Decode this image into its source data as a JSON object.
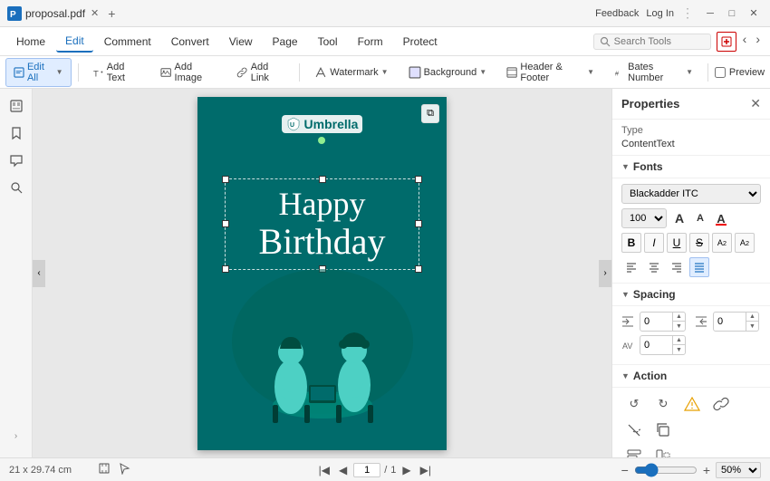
{
  "titlebar": {
    "filename": "proposal.pdf",
    "feedback": "Feedback",
    "login": "Log In"
  },
  "menubar": {
    "items": [
      {
        "label": "Home",
        "active": false
      },
      {
        "label": "Edit",
        "active": true
      },
      {
        "label": "Comment",
        "active": false
      },
      {
        "label": "Convert",
        "active": false
      },
      {
        "label": "View",
        "active": false
      },
      {
        "label": "Page",
        "active": false
      },
      {
        "label": "Tool",
        "active": false
      },
      {
        "label": "Form",
        "active": false
      },
      {
        "label": "Protect",
        "active": false
      }
    ],
    "search_placeholder": "Search Tools"
  },
  "toolbar": {
    "edit_all": "Edit All",
    "add_text": "Add Text",
    "add_image": "Add Image",
    "add_link": "Add Link",
    "watermark": "Watermark",
    "background": "Background",
    "header_footer": "Header & Footer",
    "bates_number": "Bates Number",
    "preview": "Preview"
  },
  "properties_panel": {
    "title": "Properties",
    "type_label": "Type",
    "type_value": "ContentText",
    "fonts_label": "Fonts",
    "font_family": "Blackadder ITC",
    "font_size": "100",
    "spacing_label": "Spacing",
    "spacing_indent": "0",
    "spacing_right": "0",
    "spacing_av": "0",
    "action_label": "Action"
  },
  "canvas": {
    "umbrella_text": "Umbrella",
    "happy_text": "Happy",
    "birthday_text": "Birthday",
    "copy_icon": "⧉"
  },
  "statusbar": {
    "dimensions": "21 x 29.74 cm",
    "page_current": "1",
    "page_total": "1",
    "zoom": "50%"
  }
}
